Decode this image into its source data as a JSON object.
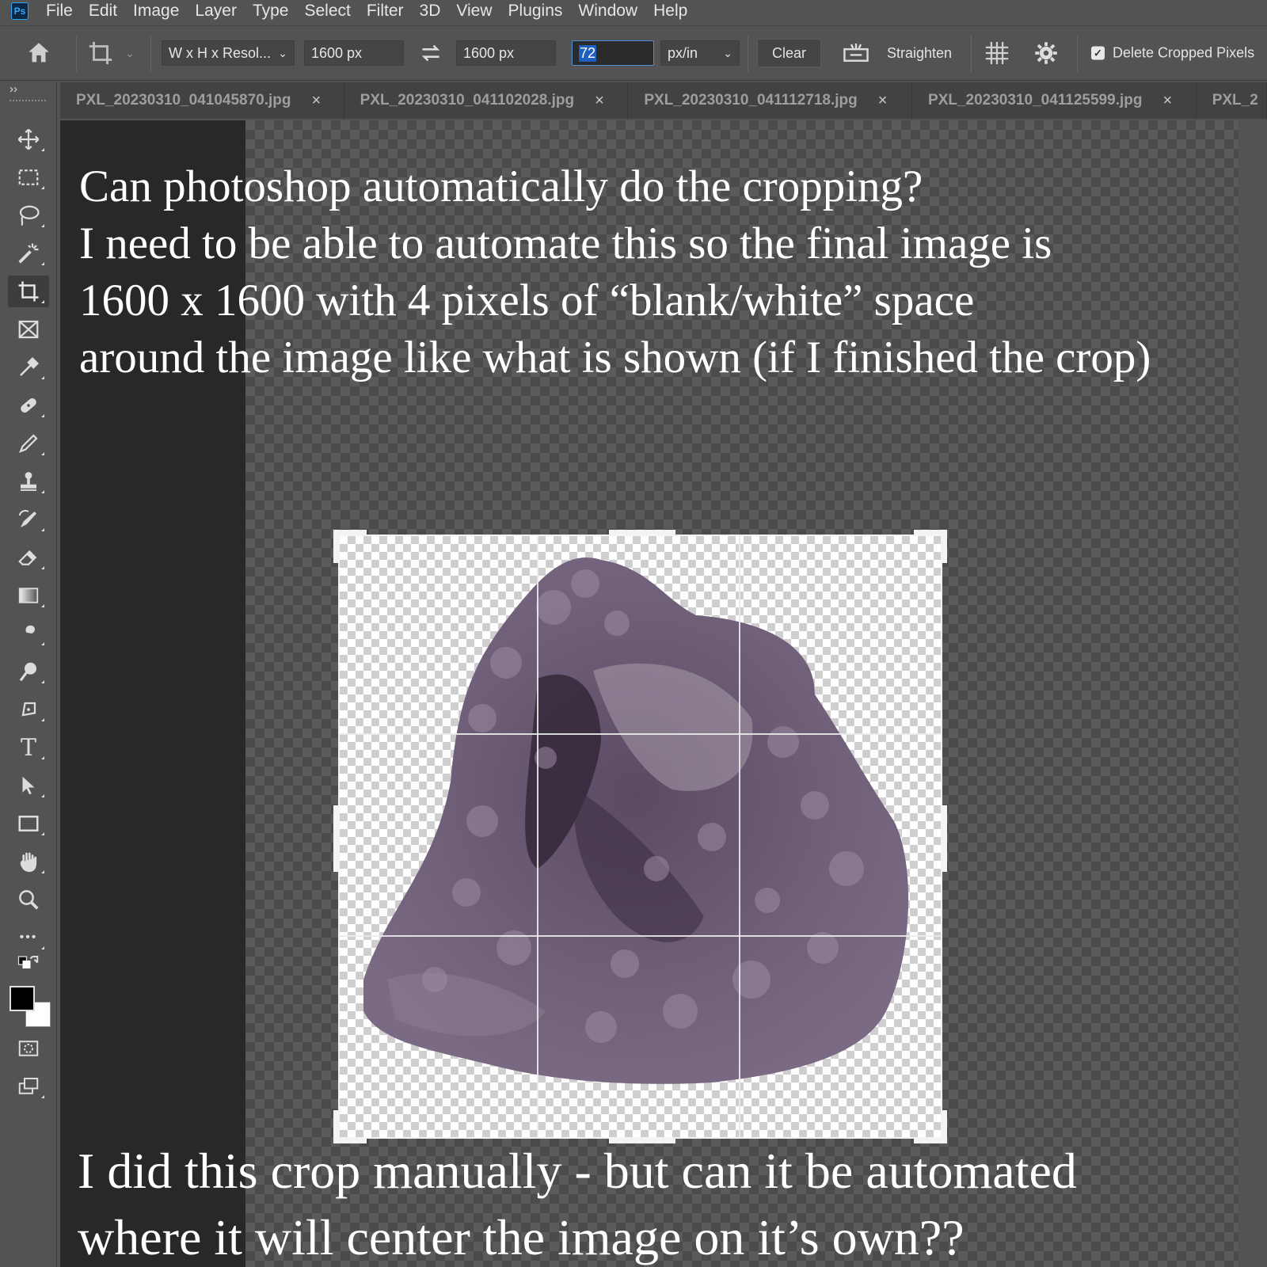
{
  "menubar": {
    "logo": "Ps",
    "items": [
      "File",
      "Edit",
      "Image",
      "Layer",
      "Type",
      "Select",
      "Filter",
      "3D",
      "View",
      "Plugins",
      "Window",
      "Help"
    ]
  },
  "options": {
    "preset": "W x H x Resol...",
    "width": "1600 px",
    "height": "1600 px",
    "resolution": "72",
    "resolution_unit": "px/in",
    "clear_label": "Clear",
    "straighten_label": "Straighten",
    "delete_cropped_label": "Delete Cropped Pixels",
    "delete_cropped_checked": true
  },
  "tabs": [
    {
      "label": "PXL_20230310_041045870.jpg"
    },
    {
      "label": "PXL_20230310_041102028.jpg"
    },
    {
      "label": "PXL_20230310_041112718.jpg"
    },
    {
      "label": "PXL_20230310_041125599.jpg"
    },
    {
      "label": "PXL_2"
    }
  ],
  "tab_close": "×",
  "toolbar": {
    "collapse": "››",
    "tools": [
      "move-tool",
      "rectangular-marquee-tool",
      "lasso-tool",
      "magic-wand-tool",
      "crop-tool",
      "frame-tool",
      "eyedropper-tool",
      "healing-brush-tool",
      "brush-tool",
      "clone-stamp-tool",
      "history-brush-tool",
      "eraser-tool",
      "gradient-tool",
      "smudge-tool",
      "dodge-tool",
      "pen-tool",
      "type-tool",
      "path-selection-tool",
      "rectangle-tool",
      "hand-tool",
      "zoom-tool",
      "more-tools"
    ],
    "type_glyph": "T",
    "more_glyph": "•••",
    "foreground_color": "#000000",
    "background_color": "#ffffff"
  },
  "annotation": {
    "top_lines": [
      "Can photoshop automatically do the cropping?",
      "I need to be able to automate this so the final image is",
      "1600 x 1600 with 4 pixels of “blank/white” space",
      "around the image like what is shown (if I finished the crop)"
    ],
    "bottom_lines": [
      "I did this crop manually - but can it be automated",
      "where it will center the image on it’s own??"
    ]
  },
  "colors": {
    "ui_bg": "#535353",
    "canvas_bg": "#282828",
    "accent_blue": "#31a8ff",
    "crystal_purple": "#6f5f79"
  }
}
